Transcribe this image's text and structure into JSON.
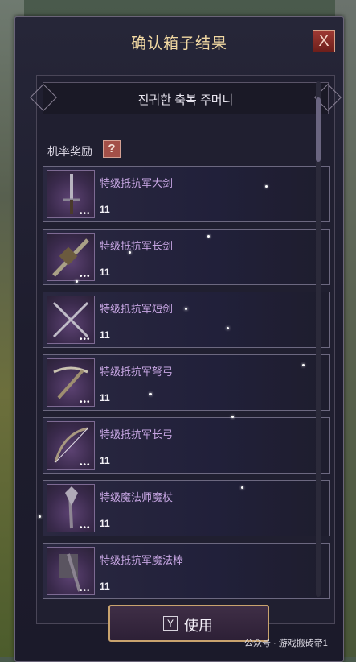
{
  "window": {
    "title": "确认箱子结果",
    "close_label": "X"
  },
  "header": {
    "box_name": "진귀한 축복 주머니"
  },
  "section": {
    "label": "机率奖励",
    "help_label": "?"
  },
  "items": [
    {
      "name": "特级抵抗军大剑",
      "qty": "11",
      "icon": "greatsword-icon"
    },
    {
      "name": "特级抵抗军长剑",
      "qty": "11",
      "icon": "longsword-icon"
    },
    {
      "name": "特级抵抗军短剑",
      "qty": "11",
      "icon": "dagger-icon"
    },
    {
      "name": "特级抵抗军弩弓",
      "qty": "11",
      "icon": "crossbow-icon"
    },
    {
      "name": "特级抵抗军长弓",
      "qty": "11",
      "icon": "longbow-icon"
    },
    {
      "name": "特级魔法师魔杖",
      "qty": "11",
      "icon": "wand-icon"
    },
    {
      "name": "特级抵抗军魔法棒",
      "qty": "11",
      "icon": "staff-icon"
    }
  ],
  "thumb_dots": "•••",
  "footer": {
    "key_hint": "Y",
    "use_label": "使用"
  },
  "watermark": "公众号 · 游戏搬砖帝1",
  "colors": {
    "title": "#f1d8a2",
    "item_name": "#c7a6e3",
    "button_border": "#c9a36e"
  }
}
